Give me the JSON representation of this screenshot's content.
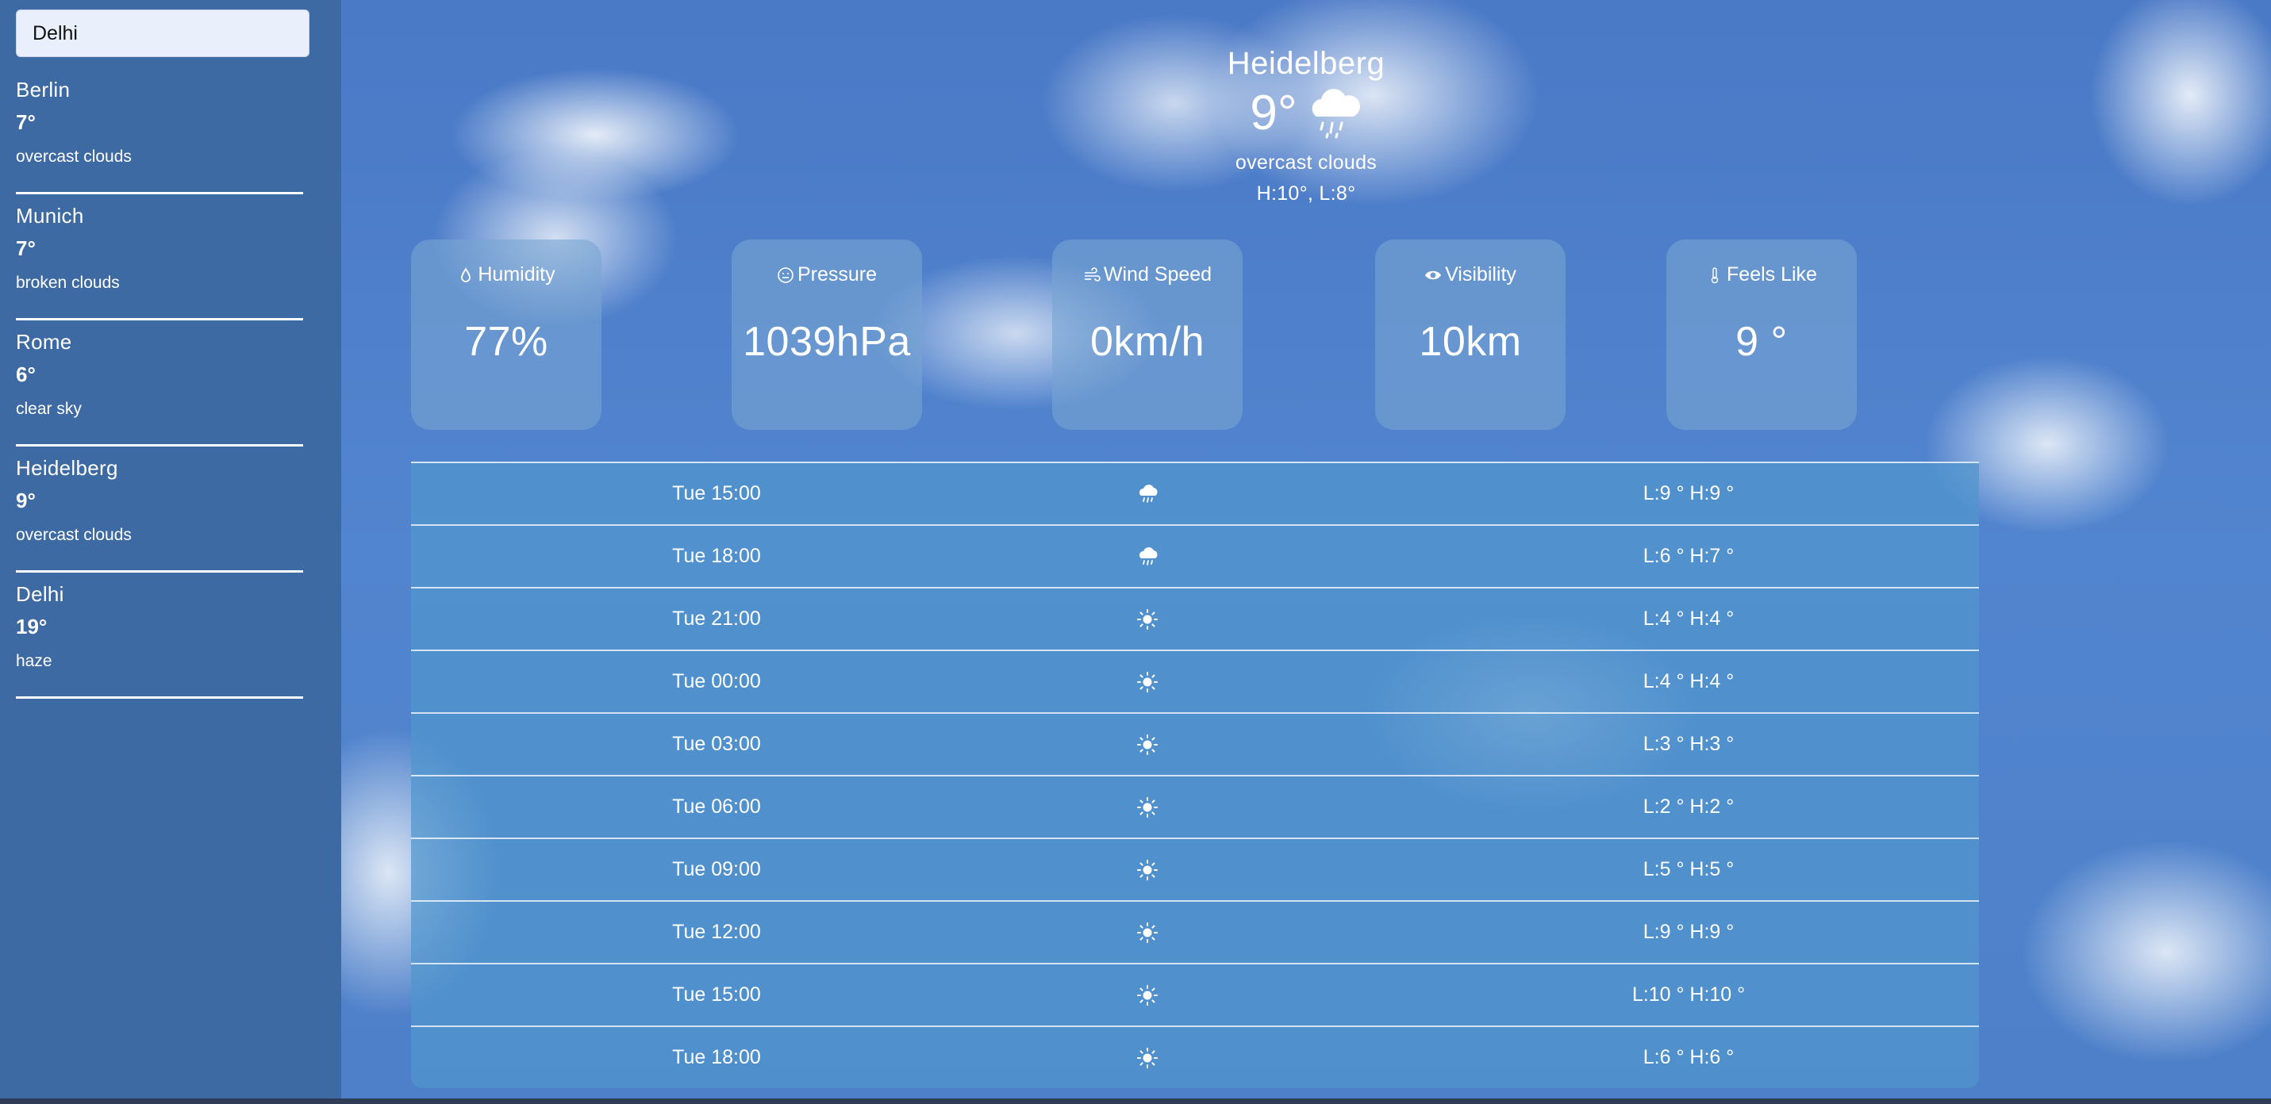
{
  "search": {
    "value": "Delhi"
  },
  "sidebar": {
    "cities": [
      {
        "name": "Berlin",
        "temp": "7°",
        "desc": "overcast clouds"
      },
      {
        "name": "Munich",
        "temp": "7°",
        "desc": "broken clouds"
      },
      {
        "name": "Rome",
        "temp": "6°",
        "desc": "clear sky"
      },
      {
        "name": "Heidelberg",
        "temp": "9°",
        "desc": "overcast clouds"
      },
      {
        "name": "Delhi",
        "temp": "19°",
        "desc": "haze"
      }
    ]
  },
  "current": {
    "city": "Heidelberg",
    "temp": "9°",
    "icon": "rain-cloud-icon",
    "desc": "overcast clouds",
    "high_low": "H:10°, L:8°"
  },
  "cards": [
    {
      "title": "Humidity",
      "icon": "droplet-icon",
      "value": "77%"
    },
    {
      "title": "Pressure",
      "icon": "gauge-icon",
      "value": "1039hPa"
    },
    {
      "title": "Wind Speed",
      "icon": "wind-icon",
      "value": "0km/h"
    },
    {
      "title": "Visibility",
      "icon": "eye-icon",
      "value": "10km"
    },
    {
      "title": "Feels Like",
      "icon": "thermometer-icon",
      "value": "9 °"
    }
  ],
  "forecast": [
    {
      "time": "Tue 15:00",
      "icon": "rain-cloud-icon",
      "lh": "L:9 ° H:9 °"
    },
    {
      "time": "Tue 18:00",
      "icon": "rain-cloud-icon",
      "lh": "L:6 ° H:7 °"
    },
    {
      "time": "Tue 21:00",
      "icon": "sun-icon",
      "lh": "L:4 ° H:4 °"
    },
    {
      "time": "Tue 00:00",
      "icon": "sun-icon",
      "lh": "L:4 ° H:4 °"
    },
    {
      "time": "Tue 03:00",
      "icon": "sun-icon",
      "lh": "L:3 ° H:3 °"
    },
    {
      "time": "Tue 06:00",
      "icon": "sun-icon",
      "lh": "L:2 ° H:2 °"
    },
    {
      "time": "Tue 09:00",
      "icon": "sun-icon",
      "lh": "L:5 ° H:5 °"
    },
    {
      "time": "Tue 12:00",
      "icon": "sun-icon",
      "lh": "L:9 ° H:9 °"
    },
    {
      "time": "Tue 15:00",
      "icon": "sun-icon",
      "lh": "L:10 ° H:10 °"
    },
    {
      "time": "Tue 18:00",
      "icon": "sun-icon",
      "lh": "L:6 ° H:6 °"
    }
  ]
}
